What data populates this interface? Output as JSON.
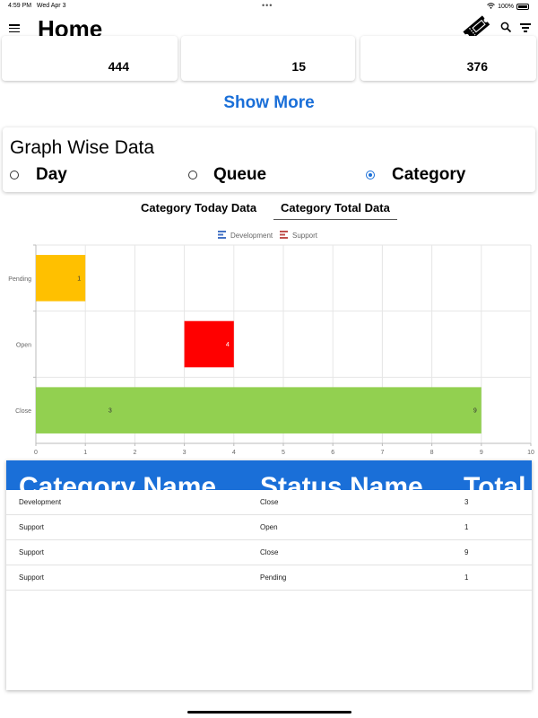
{
  "status_bar": {
    "time": "4:59 PM",
    "date": "Wed Apr 3",
    "battery": "100%"
  },
  "app_bar": {
    "title": "Home"
  },
  "stat_cards": [
    {
      "value": "444"
    },
    {
      "value": "15"
    },
    {
      "value": "376"
    }
  ],
  "show_more_label": "Show More",
  "graph_section": {
    "title": "Graph Wise Data",
    "options": [
      {
        "label": "Day",
        "selected": false
      },
      {
        "label": "Queue",
        "selected": false
      },
      {
        "label": "Category",
        "selected": true
      }
    ]
  },
  "chart_tabs": [
    {
      "label": "Category Today Data",
      "active": false
    },
    {
      "label": "Category Total Data",
      "active": true
    }
  ],
  "chart_data": {
    "type": "bar",
    "orientation": "horizontal",
    "stacked": true,
    "categories": [
      "Pending",
      "Open",
      "Close"
    ],
    "series": [
      {
        "name": "Development",
        "values": [
          0,
          0,
          3
        ]
      },
      {
        "name": "Support",
        "values": [
          1,
          1,
          9
        ]
      }
    ],
    "bars": [
      {
        "category": "Pending",
        "start": 0,
        "end": 1,
        "label": "1",
        "color": "#FFC000"
      },
      {
        "category": "Open",
        "start": 3,
        "end": 4,
        "label": "4",
        "color": "#FF0000"
      },
      {
        "category": "Close",
        "start": 0,
        "end": 9,
        "label": "9",
        "inner_label": "3",
        "color": "#92D050"
      }
    ],
    "x_ticks": [
      "0",
      "1",
      "2",
      "3",
      "4",
      "5",
      "6",
      "7",
      "8",
      "9",
      "10"
    ],
    "xlim": [
      0,
      10
    ],
    "grid": true,
    "legend_position": "top",
    "legend_colors": {
      "Development": "#4472C4",
      "Support": "#C0504D"
    }
  },
  "table": {
    "headers": [
      "Category Name",
      "Status Name",
      "Total"
    ],
    "rows": [
      [
        "Development",
        "Close",
        "3"
      ],
      [
        "Support",
        "Open",
        "1"
      ],
      [
        "Support",
        "Close",
        "9"
      ],
      [
        "Support",
        "Pending",
        "1"
      ]
    ]
  },
  "colors": {
    "accent": "#1A6FD8"
  }
}
